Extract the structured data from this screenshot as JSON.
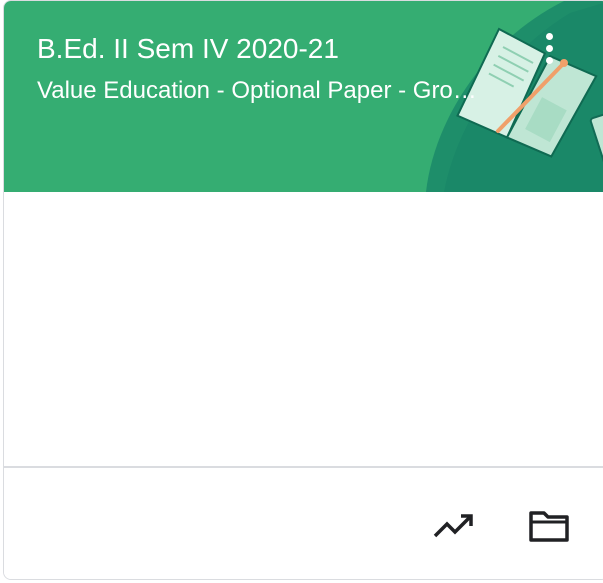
{
  "course": {
    "title": "B.Ed. II Sem IV 2020-21",
    "section": "Value Education - Optional Paper - Group B"
  },
  "colors": {
    "header_background": "#35ad72",
    "header_accent": "#1e8e6a",
    "book_page": "#cfeee0",
    "book_ribbon": "#f0a06a",
    "icon_color": "#202124"
  },
  "icons": {
    "menu": "more-vertical-icon",
    "grades": "trending-up-icon",
    "drive": "folder-icon",
    "illustration": "open-book-illustration"
  }
}
